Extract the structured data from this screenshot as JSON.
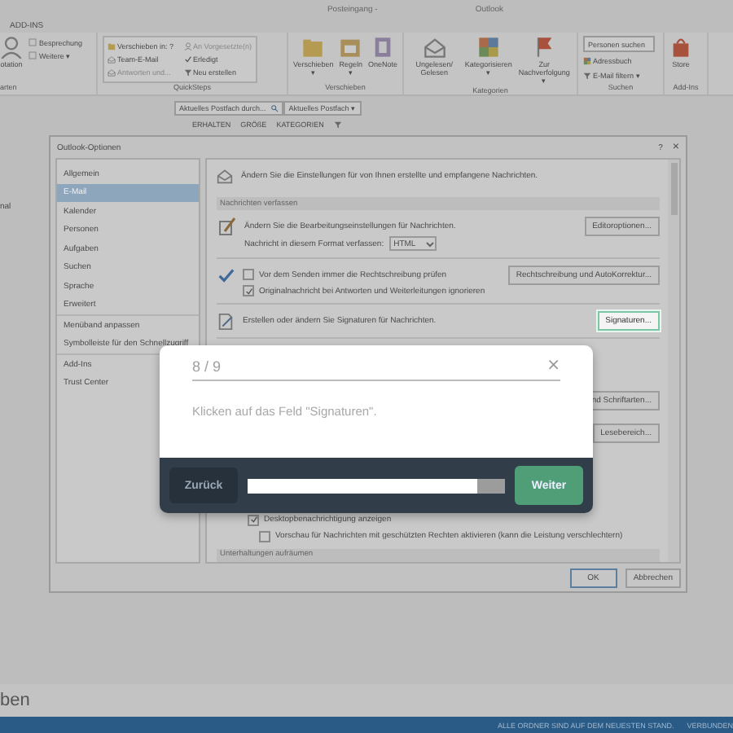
{
  "window": {
    "title": "Posteingang -",
    "app_name": "Outlook"
  },
  "ribbon_tabs": [
    {
      "label": "ADD-INS"
    }
  ],
  "ribbon": {
    "left_group": {
      "label": "arten",
      "large_label": "otation",
      "items": [
        "Besprechung",
        "Weitere ▾"
      ]
    },
    "quicksteps": {
      "label": "QuickSteps",
      "items": [
        {
          "label": "Verschieben in: ?",
          "disabled": false
        },
        {
          "label": "An Vorgesetzte(n)",
          "disabled": true
        },
        {
          "label": "Team-E-Mail",
          "disabled": false
        },
        {
          "label": "Erledigt",
          "disabled": false
        },
        {
          "label": "Antworten und...",
          "disabled": true
        },
        {
          "label": "Neu erstellen",
          "disabled": false
        }
      ]
    },
    "move_group": {
      "label": "Verschieben",
      "buttons": [
        "Verschieben ▾",
        "Regeln ▾",
        "OneNote"
      ]
    },
    "tags_group": {
      "label": "Kategorien",
      "buttons": [
        "Ungelesen/ Gelesen",
        "Kategorisieren ▾",
        "Zur Nachverfolgung ▾"
      ]
    },
    "find_group": {
      "label": "Suchen",
      "placeholder": "Personen suchen",
      "items": [
        "Adressbuch",
        "E-Mail filtern ▾"
      ]
    },
    "addins_group": {
      "label": "Add-Ins",
      "button": "Store"
    }
  },
  "search_bar": {
    "placeholder": "Aktuelles Postfach durch...",
    "scope": "Aktuelles Postfach ▾"
  },
  "columns": [
    "ERHALTEN",
    "GRÖßE",
    "KATEGORIEN"
  ],
  "folder_pane": {
    "items": [
      "nal"
    ]
  },
  "bottom_label": "ben",
  "status_bar": [
    "ALLE ORDNER SIND AUF DEM NEUESTEN STAND.",
    "VERBUNDEN"
  ],
  "dialog": {
    "title": "Outlook-Optionen",
    "help": "?",
    "close": "×",
    "nav_groups": [
      [
        {
          "label": "Allgemein",
          "selected": false
        },
        {
          "label": "E-Mail",
          "selected": true
        },
        {
          "label": "Kalender",
          "selected": false
        },
        {
          "label": "Personen",
          "selected": false
        },
        {
          "label": "Aufgaben",
          "selected": false
        },
        {
          "label": "Suchen",
          "selected": false
        },
        {
          "label": "Sprache",
          "selected": false
        },
        {
          "label": "Erweitert",
          "selected": false
        }
      ],
      [
        {
          "label": "Menüband anpassen",
          "selected": false
        },
        {
          "label": "Symbolleiste für den Schnellzugriff",
          "selected": false
        }
      ],
      [
        {
          "label": "Add-Ins",
          "selected": false
        },
        {
          "label": "Trust Center",
          "selected": false
        }
      ]
    ],
    "content": {
      "intro": "Ändern Sie die Einstellungen für von Ihnen erstellte und empfangene Nachrichten.",
      "section_1": "Nachrichten verfassen",
      "editor_text": "Ändern Sie die Bearbeitungseinstellungen für Nachrichten.",
      "editor_button": "Editoroptionen...",
      "format_label": "Nachricht in diesem Format verfassen:",
      "format_value": "HTML",
      "spelling_checks": [
        {
          "label": "Vor dem Senden immer die Rechtschreibung prüfen",
          "checked": false
        },
        {
          "label": "Originalnachricht bei Antworten und Weiterleitungen ignorieren",
          "checked": true
        }
      ],
      "spelling_button": "Rechtschreibung und AutoKorrektur...",
      "signature_text": "Erstellen oder ändern Sie Signaturen für Nachrichten.",
      "signature_button": {
        "label": "Signaturen...",
        "highlighted": true
      },
      "fonts_button": "nd Schriftarten...",
      "reading_pane_button": "Lesebereich...",
      "notification_checks": [
        {
          "label": "Desktopbenachrichtigung anzeigen",
          "checked": true
        },
        {
          "label": "Vorschau für Nachrichten mit geschützten Rechten aktivieren (kann die Leistung verschlechtern)",
          "checked": false
        }
      ],
      "section_2": "Unterhaltungen aufräumen"
    },
    "buttons": [
      "OK",
      "Abbrechen"
    ]
  },
  "tour": {
    "step": "8 / 9",
    "close": "×",
    "message": "Klicken auf das Feld \"Signaturen\".",
    "back": "Zurück",
    "level": 0.89,
    "next": "Weiter"
  }
}
